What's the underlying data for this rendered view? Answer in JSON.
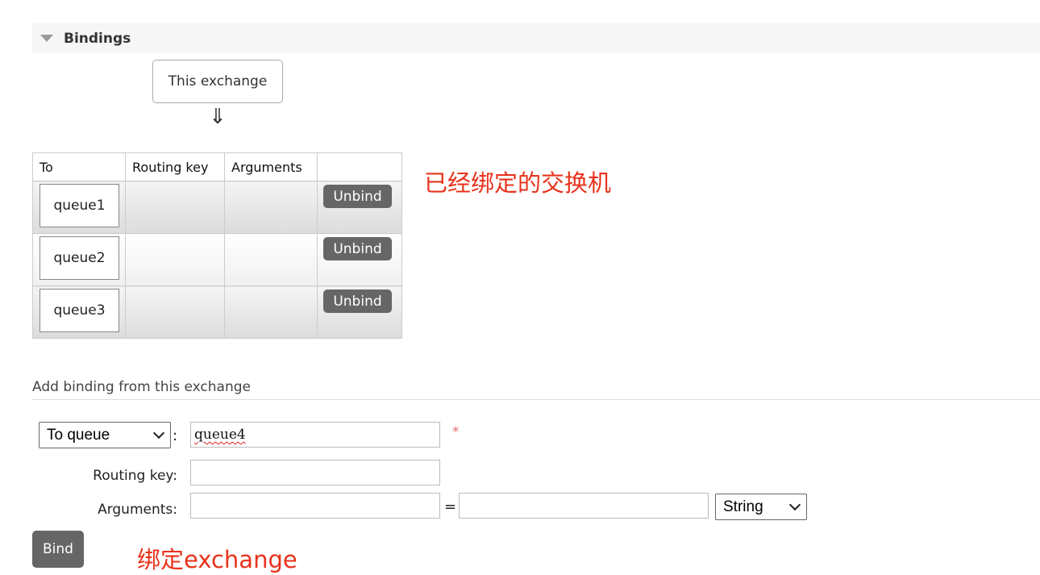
{
  "section": {
    "title": "Bindings"
  },
  "exchange_box": {
    "label": "This exchange",
    "arrow": "⇓"
  },
  "table": {
    "headers": [
      "To",
      "Routing key",
      "Arguments",
      ""
    ],
    "rows": [
      {
        "to": "queue1",
        "routing_key": "",
        "arguments": "",
        "action": "Unbind"
      },
      {
        "to": "queue2",
        "routing_key": "",
        "arguments": "",
        "action": "Unbind"
      },
      {
        "to": "queue3",
        "routing_key": "",
        "arguments": "",
        "action": "Unbind"
      }
    ]
  },
  "annotations": {
    "bound_exchanges": "已经绑定的交换机",
    "bind_exchange": "绑定exchange"
  },
  "add_binding": {
    "title": "Add binding from this exchange",
    "destination_type": "To queue",
    "colon": ":",
    "destination_value": "queue4",
    "required_marker": "*",
    "routing_key_label": "Routing key:",
    "routing_key_value": "",
    "arguments_label": "Arguments:",
    "argument_key": "",
    "equals": "=",
    "argument_value": "",
    "argument_type": "String",
    "bind_label": "Bind"
  },
  "colors": {
    "button_bg": "#666666",
    "annotation": "#e8331c",
    "header_bg": "#f6f6f6"
  },
  "icons": {
    "collapse": "triangle-down-icon",
    "select": "chevron-down-icon"
  }
}
